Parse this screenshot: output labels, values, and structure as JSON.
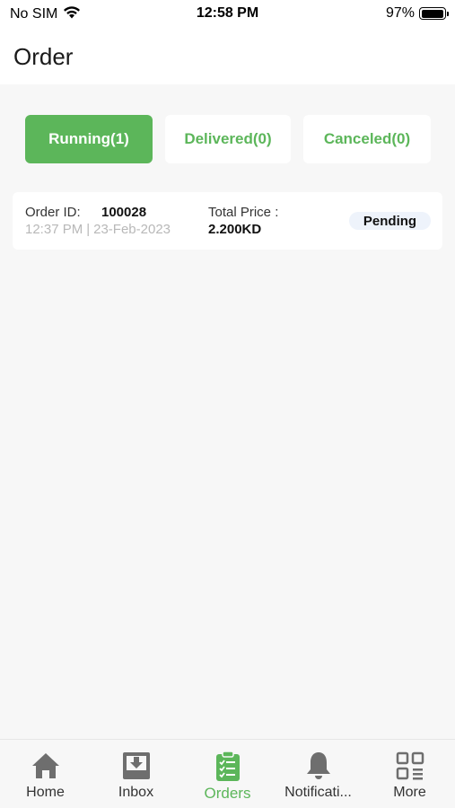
{
  "status_bar": {
    "carrier": "No SIM",
    "time": "12:58 PM",
    "battery_percent_text": "97%",
    "battery_level": 0.97
  },
  "header": {
    "title": "Order"
  },
  "tabs": [
    {
      "label": "Running(1)",
      "active": true
    },
    {
      "label": "Delivered(0)",
      "active": false
    },
    {
      "label": "Canceled(0)",
      "active": false
    }
  ],
  "orders": [
    {
      "id_label": "Order ID:",
      "id": "100028",
      "time": "12:37 PM",
      "separator": "|",
      "date": "23-Feb-2023",
      "price_label": "Total Price :",
      "price": "2.200KD",
      "status": "Pending"
    }
  ],
  "bottom_nav": [
    {
      "label": "Home",
      "icon": "home-icon",
      "active": false
    },
    {
      "label": "Inbox",
      "icon": "inbox-icon",
      "active": false
    },
    {
      "label": "Orders",
      "icon": "orders-clipboard-icon",
      "active": true
    },
    {
      "label": "Notificati...",
      "icon": "bell-icon",
      "active": false
    },
    {
      "label": "More",
      "icon": "grid-icon",
      "active": false
    }
  ],
  "colors": {
    "accent": "#5cb65a",
    "background": "#f7f7f7",
    "icon_gray": "#6e6e6e",
    "muted_text": "#b8b8b8",
    "badge_bg": "#eef3fb"
  }
}
